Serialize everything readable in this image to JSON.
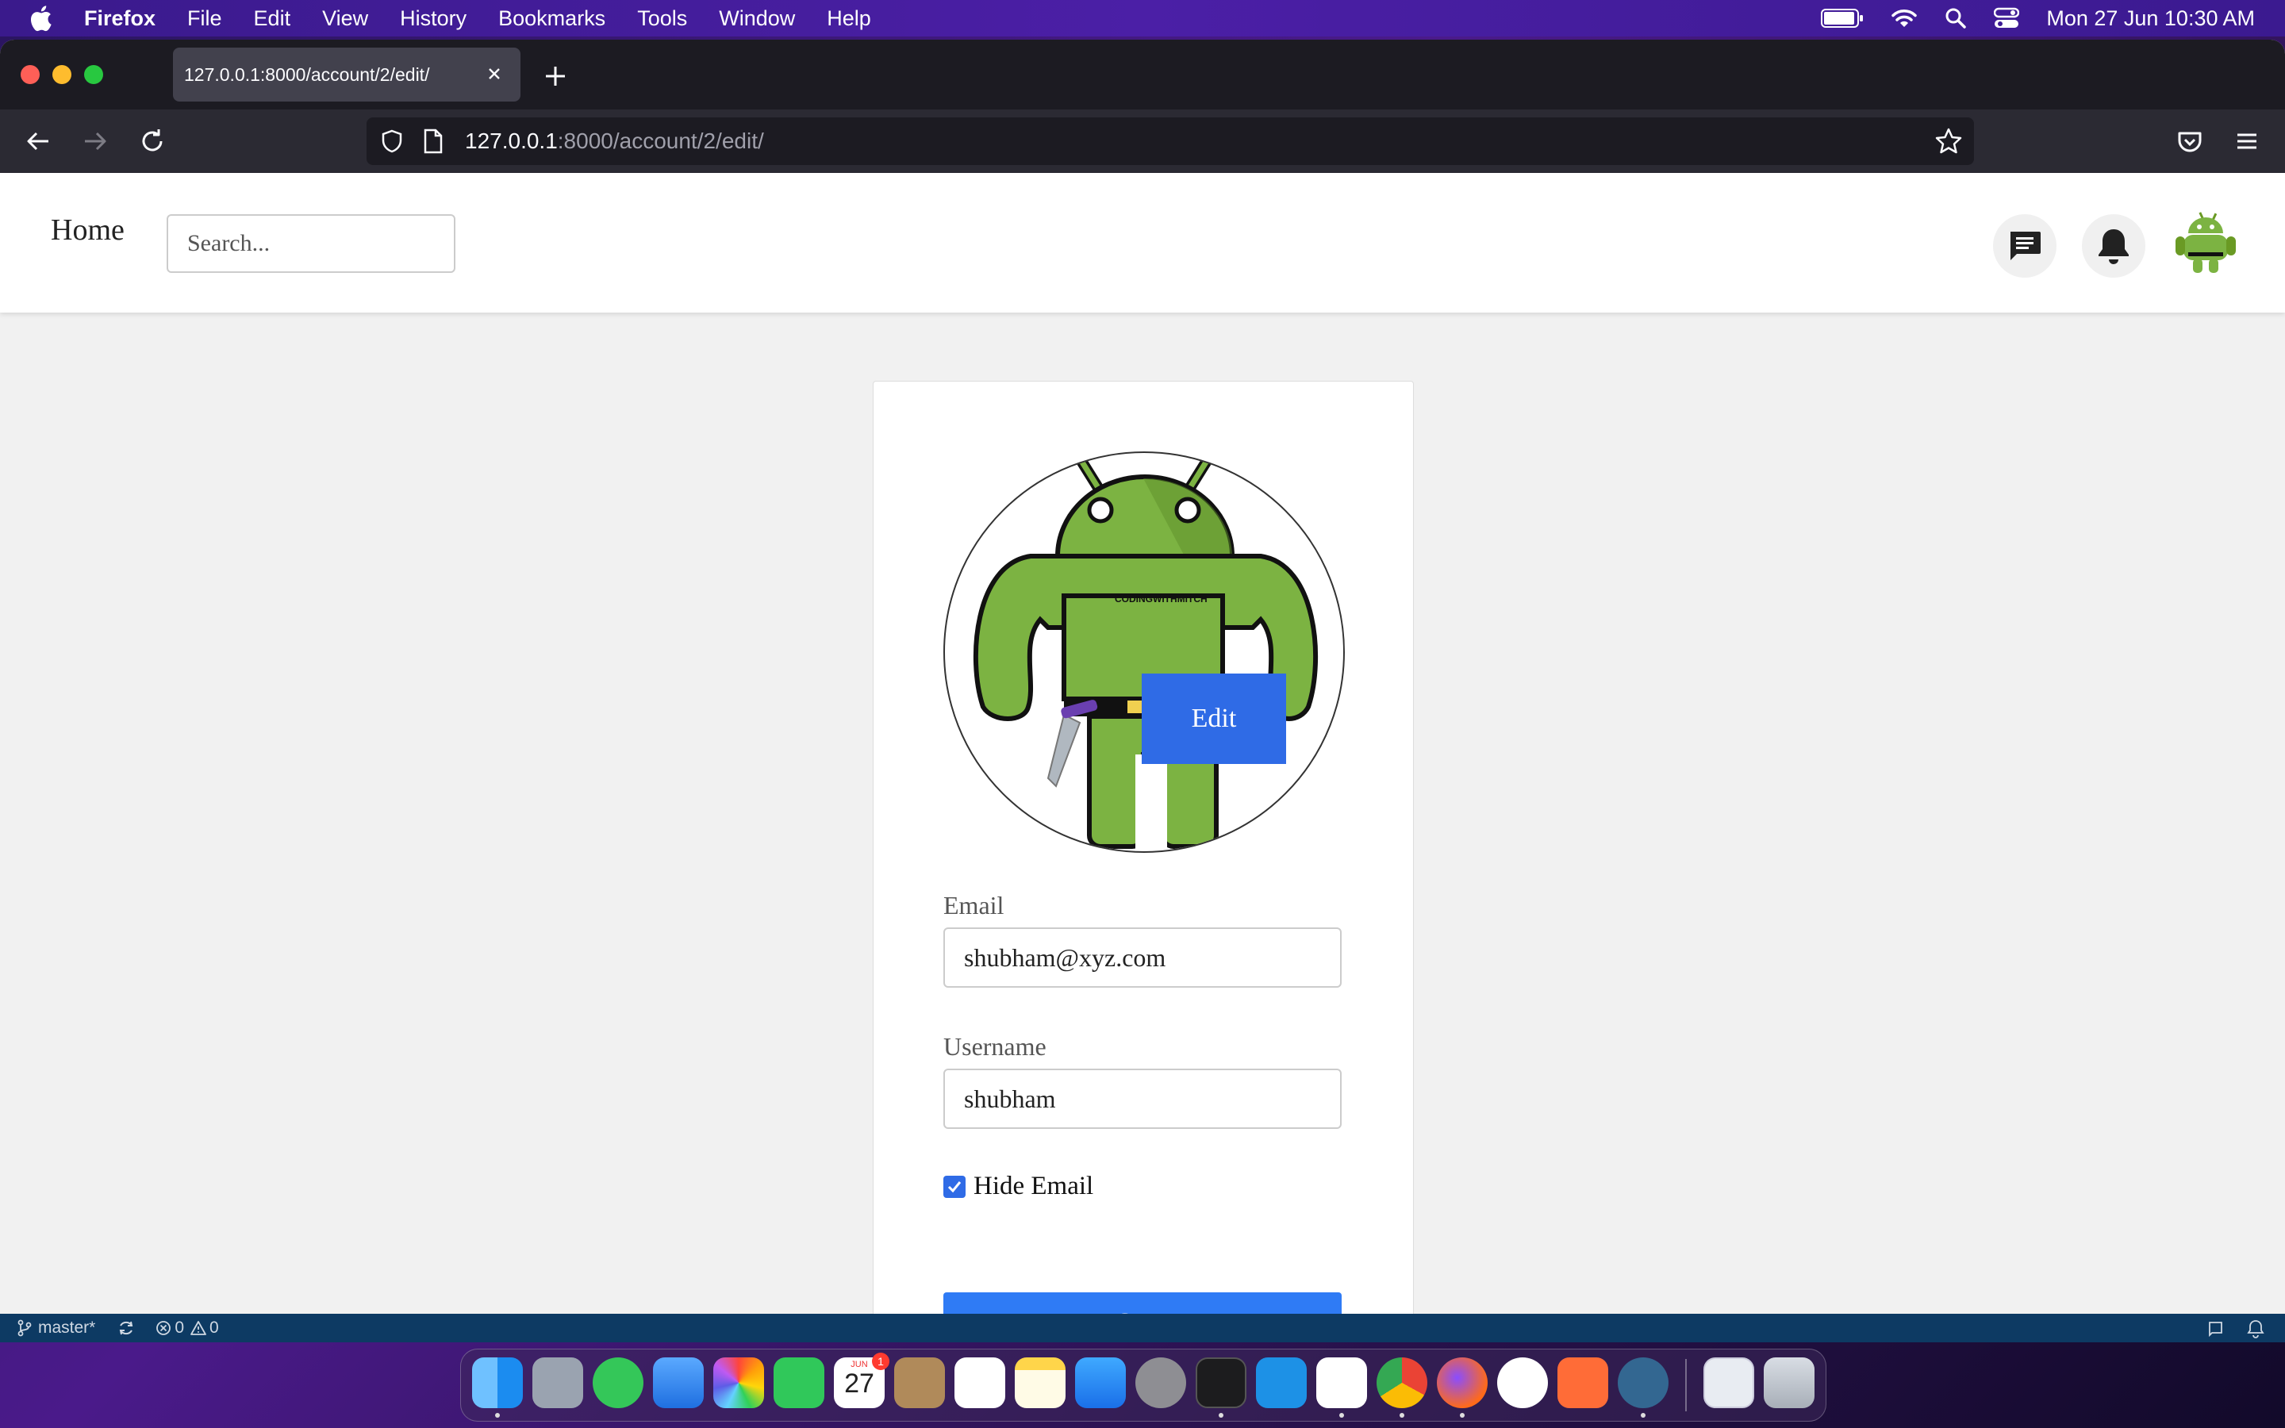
{
  "menubar": {
    "app_name": "Firefox",
    "items": [
      "File",
      "Edit",
      "View",
      "History",
      "Bookmarks",
      "Tools",
      "Window",
      "Help"
    ],
    "clock": "Mon 27 Jun  10:30 AM"
  },
  "browser": {
    "tab_title": "127.0.0.1:8000/account/2/edit/",
    "url_host": "127.0.0.1",
    "url_rest": ":8000/account/2/edit/"
  },
  "site": {
    "home_label": "Home",
    "search_placeholder": "Search..."
  },
  "form": {
    "edit_label": "Edit",
    "logo_text": "CODINGWITHMITCH",
    "email_label": "Email",
    "email_value": "shubham@xyz.com",
    "username_label": "Username",
    "username_value": "shubham",
    "hide_email_label": "Hide Email",
    "hide_email_checked": true,
    "save_label": "Save"
  },
  "statusbar": {
    "branch": "master*",
    "errors": "0",
    "warnings": "0"
  },
  "dock": {
    "calendar_month": "JUN",
    "calendar_day": "27",
    "calendar_badge": "1"
  },
  "colors": {
    "primary_button": "#2f7bf5",
    "edit_overlay": "#2f6be6",
    "android_green": "#7cb342"
  }
}
